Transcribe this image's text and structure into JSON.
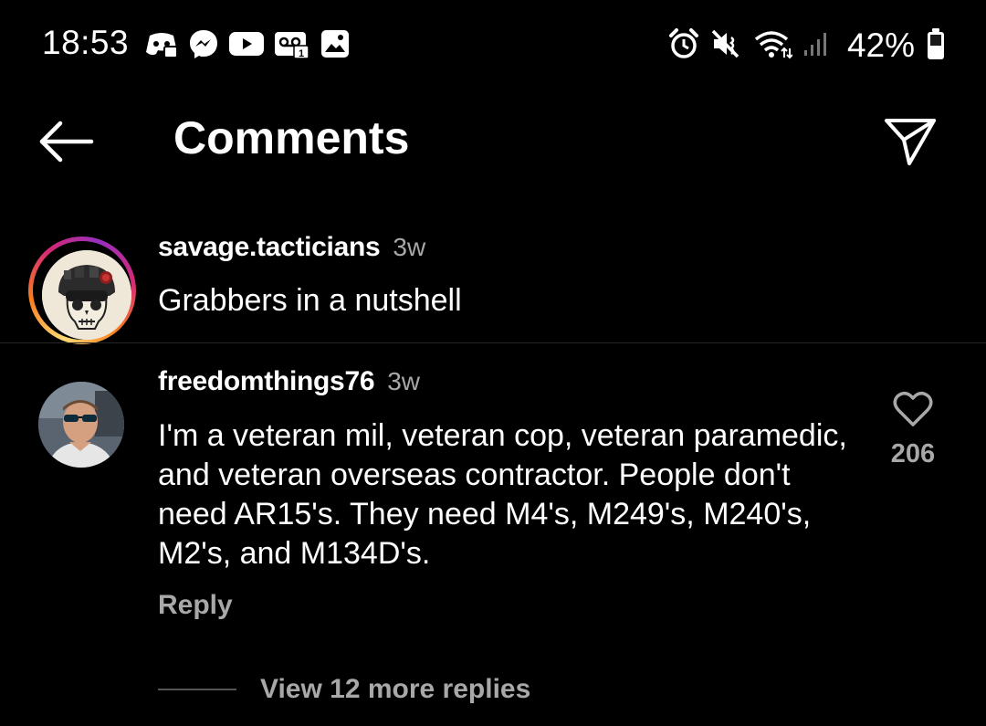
{
  "status_bar": {
    "time": "18:53",
    "battery": "42%",
    "left_icons": [
      "discord-icon",
      "messenger-icon",
      "youtube-icon",
      "voicemail-icon",
      "gallery-icon"
    ],
    "right_icons": [
      "alarm-icon",
      "mute-icon",
      "wifi-icon",
      "signal-icon",
      "battery-icon"
    ]
  },
  "header": {
    "title": "Comments",
    "back_icon": "arrow-left-icon",
    "share_icon": "send-icon"
  },
  "caption": {
    "username": "savage.tacticians",
    "time": "3w",
    "text": "Grabbers in a nutshell",
    "avatar": "skull-logo-avatar",
    "story_ring": true
  },
  "comment": {
    "username": "freedomthings76",
    "time": "3w",
    "text": "I'm a veteran mil, veteran cop, veteran paramedic, and veteran overseas contractor. People don't need AR15's. They need M4's, M249's, M240's, M2's, and M134D's.",
    "likes": "206",
    "reply_label": "Reply",
    "avatar": "user-photo-avatar"
  },
  "replies": {
    "label": "View 12 more replies"
  },
  "colors": {
    "background": "#000000",
    "text": "#ffffff",
    "secondary_text": "#a8a8a8",
    "divider": "#262626"
  }
}
